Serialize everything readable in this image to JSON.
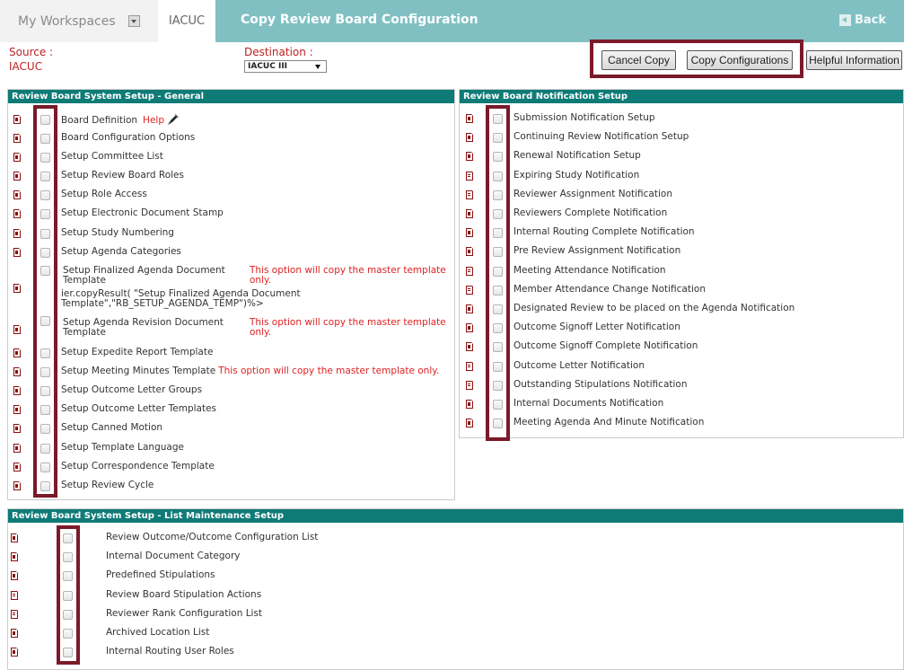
{
  "header": {
    "workspaces": "My Workspaces",
    "tab": "IACUC",
    "title": "Copy Review Board Configuration",
    "back": "Back"
  },
  "source": {
    "label": "Source :",
    "value": "IACUC"
  },
  "destination": {
    "label": "Destination :",
    "value": "IACUC III"
  },
  "buttons": {
    "cancel": "Cancel Copy",
    "copy": "Copy Configurations",
    "help": "Helpful Information"
  },
  "general": {
    "title": "Review Board System Setup - General",
    "help": "Help",
    "items": [
      "Board Definition",
      "Board Configuration Options",
      "Setup Committee List",
      "Setup Review Board Roles",
      "Setup Role Access",
      "Setup Electronic Document Stamp",
      "Setup Study Numbering",
      "Setup Agenda Categories",
      "Setup Finalized Agenda Document Template",
      "Setup Agenda Revision Document Template",
      "Setup Expedite Report Template",
      "Setup Meeting Minutes Template",
      "Setup Outcome Letter Groups",
      "Setup Outcome Letter Templates",
      "Setup Canned Motion",
      "Setup Template Language",
      "Setup Correspondence Template",
      "Setup Review Cycle"
    ],
    "note": "This option will copy the master template only.",
    "code": "ier.copyResult( \"Setup Finalized Agenda Document Template\",\"RB_SETUP_AGENDA_TEMP\")%>"
  },
  "notification": {
    "title": "Review Board  Notification Setup",
    "items": [
      "Submission Notification Setup",
      "Continuing Review Notification Setup",
      "Renewal Notification Setup",
      "Expiring Study Notification",
      "Reviewer Assignment Notification",
      "Reviewers Complete Notification",
      "Internal Routing Complete Notification",
      "Pre Review Assignment Notification",
      "Meeting Attendance Notification",
      "Member Attendance Change Notification",
      "Designated Review to be placed on the Agenda Notification",
      "Outcome Signoff Letter Notification",
      "Outcome Signoff Complete Notification",
      "Outcome Letter Notification",
      "Outstanding Stipulations Notification",
      "Internal Documents Notification",
      "Meeting Agenda And Minute Notification"
    ]
  },
  "lists": {
    "title": "Review Board System Setup - List Maintenance Setup",
    "items": [
      "Review Outcome/Outcome Configuration List",
      "Internal Document Category",
      "Predefined Stipulations",
      "Review Board Stipulation Actions",
      "Reviewer Rank Configuration List",
      "Archived Location List",
      "Internal Routing User Roles"
    ]
  },
  "colors": {
    "teal_header": "#0f7b77",
    "title_bar": "#80c0c3",
    "highlight": "#7a1a2a"
  }
}
